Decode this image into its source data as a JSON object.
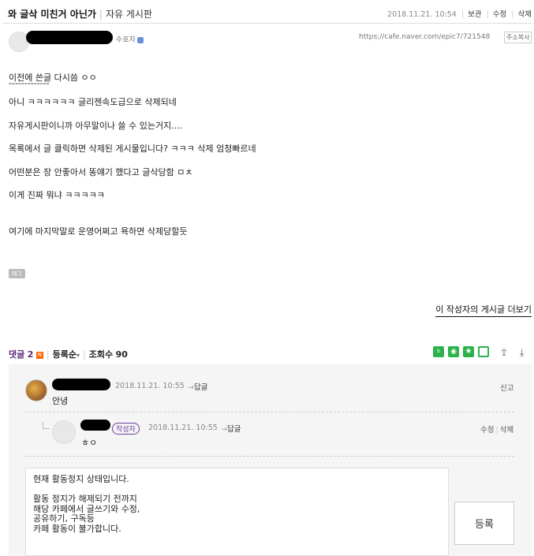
{
  "post": {
    "title": "와 글삭 미친거 아닌가",
    "board": "자유 게시판",
    "date": "2018.11.21. 10:54",
    "actions": [
      "보관",
      "수정",
      "삭제"
    ],
    "author_grade": "수호자",
    "url": "https://cafe.naver.com/epic7/721548",
    "copy_label": "주소복사",
    "body_lines": [
      "이전에 쓴글 다시씀 ㅇㅇ",
      "-------------",
      "아니 ㅋㅋㅋㅋㅋㅋ 글리젠속도급으로 삭제되네",
      "자유게시판이니까 아무말이나 쓸 수 있는거지....",
      "목록에서 글 클릭하면 삭제된 게시물입니다? ㅋㅋㅋ 삭제 엄청빠르네",
      "어떤분은 장 안좋아서 똥얘기 했다고 글삭당함 ㅁㅊ",
      "이게 진짜 뭐냐 ㅋㅋㅋㅋㅋ",
      "여기에 마지막말로 운영어쩌고 욕하면 삭제당할듯"
    ],
    "tag_label": "태그",
    "more_link": "이 작성자의 게시글 더보기"
  },
  "comments_bar": {
    "label": "댓글",
    "count": "2",
    "new_badge": "N",
    "sort": "등록순",
    "views_label": "조회수",
    "views": "90"
  },
  "comments": [
    {
      "date": "2018.11.21. 10:55",
      "reply_label": "답글",
      "report_label": "신고",
      "text": "안녕"
    },
    {
      "writer_badge": "작성자",
      "date": "2018.11.21. 10:55",
      "reply_label": "답글",
      "edit_label": "수정",
      "delete_label": "삭제",
      "text": "ㅎㅇ"
    }
  ],
  "write_box": {
    "notice": "현재 활동정지 상태입니다.\n\n활동 정지가 해제되기 전까지\n해당 카페에서 글쓰기와 수정,\n공유하기, 구독등\n카페 활동이 불가합니다.",
    "submit_label": "등록"
  },
  "icons": {
    "share": [
      "band-icon",
      "line-icon",
      "star-icon",
      "square-icon",
      "share-icon",
      "download-icon"
    ]
  },
  "colors": {
    "accent_purple": "#5a2a7a",
    "green": "#2bb34a",
    "new_badge": "#ff6600"
  }
}
